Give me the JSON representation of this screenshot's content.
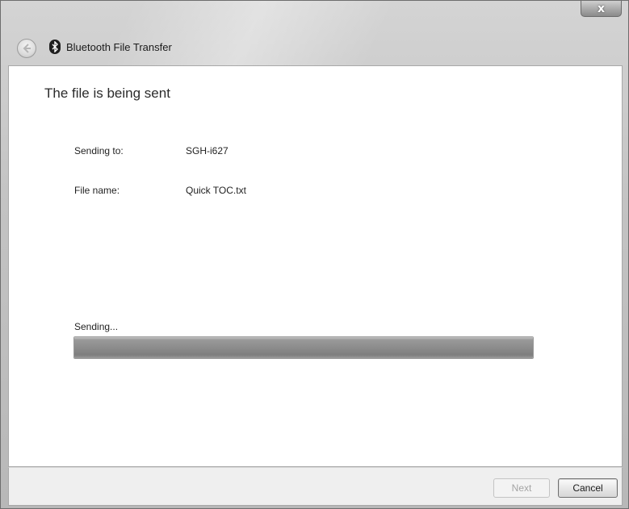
{
  "window": {
    "title": "Bluetooth File Transfer",
    "close_label": "x"
  },
  "main": {
    "heading": "The file is being sent",
    "fields": [
      {
        "label": "Sending to:",
        "value": "SGH-i627"
      },
      {
        "label": "File name:",
        "value": "Quick TOC.txt"
      }
    ],
    "progress": {
      "label": "Sending...",
      "fraction": 1.0
    }
  },
  "footer": {
    "next_label": "Next",
    "cancel_label": "Cancel"
  },
  "icons": {
    "back": "back-arrow-icon",
    "bluetooth": "bluetooth-icon",
    "close": "close-icon"
  }
}
